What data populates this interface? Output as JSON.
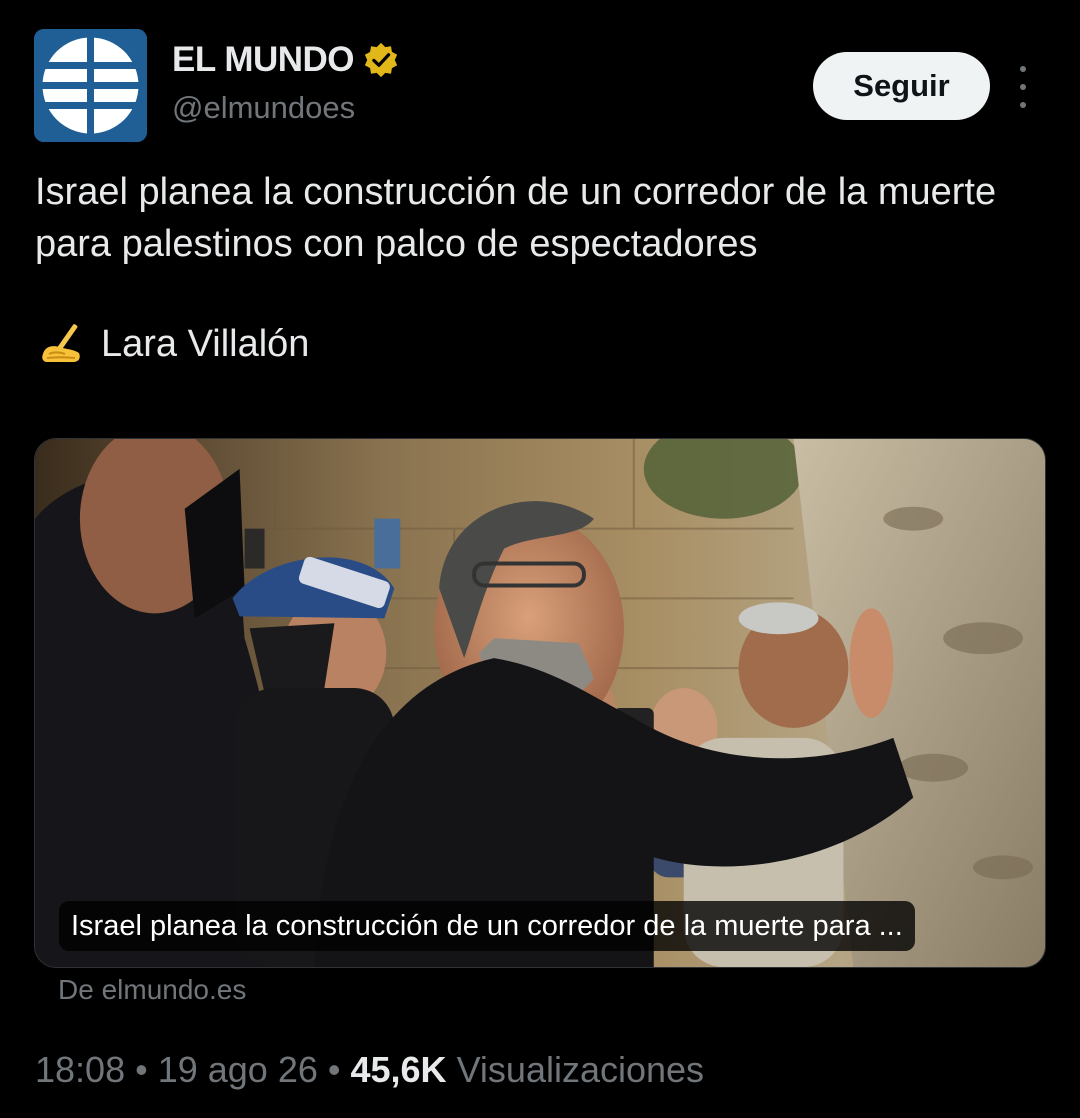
{
  "author": {
    "display_name": "EL MUNDO",
    "handle": "@elmundoes",
    "verified": true,
    "verified_color": "#e2b719",
    "avatar_icon": "el-mundo-globe-logo"
  },
  "follow_label": "Seguir",
  "more_icon": "more-vertical-icon",
  "tweet": {
    "text": "Israel planea la construcción de un corredor de la muerte para palestinos con palco de espectadores",
    "byline_emoji": "✍️",
    "byline_name": "Lara Villalón"
  },
  "card": {
    "caption": "Israel planea la construcción de un corredor de la muerte para ...",
    "source": "De elmundo.es",
    "image_description_icon": "news-photo"
  },
  "meta": {
    "time": "18:08",
    "separator": "•",
    "date": "19 ago 26",
    "views_count": "45,6K",
    "views_label": "Visualizaciones"
  },
  "colors": {
    "background": "#000000",
    "text_primary": "#e7e9ea",
    "text_secondary": "#71767b",
    "button_bg": "#eff3f4",
    "avatar_bg": "#1f5f96"
  }
}
